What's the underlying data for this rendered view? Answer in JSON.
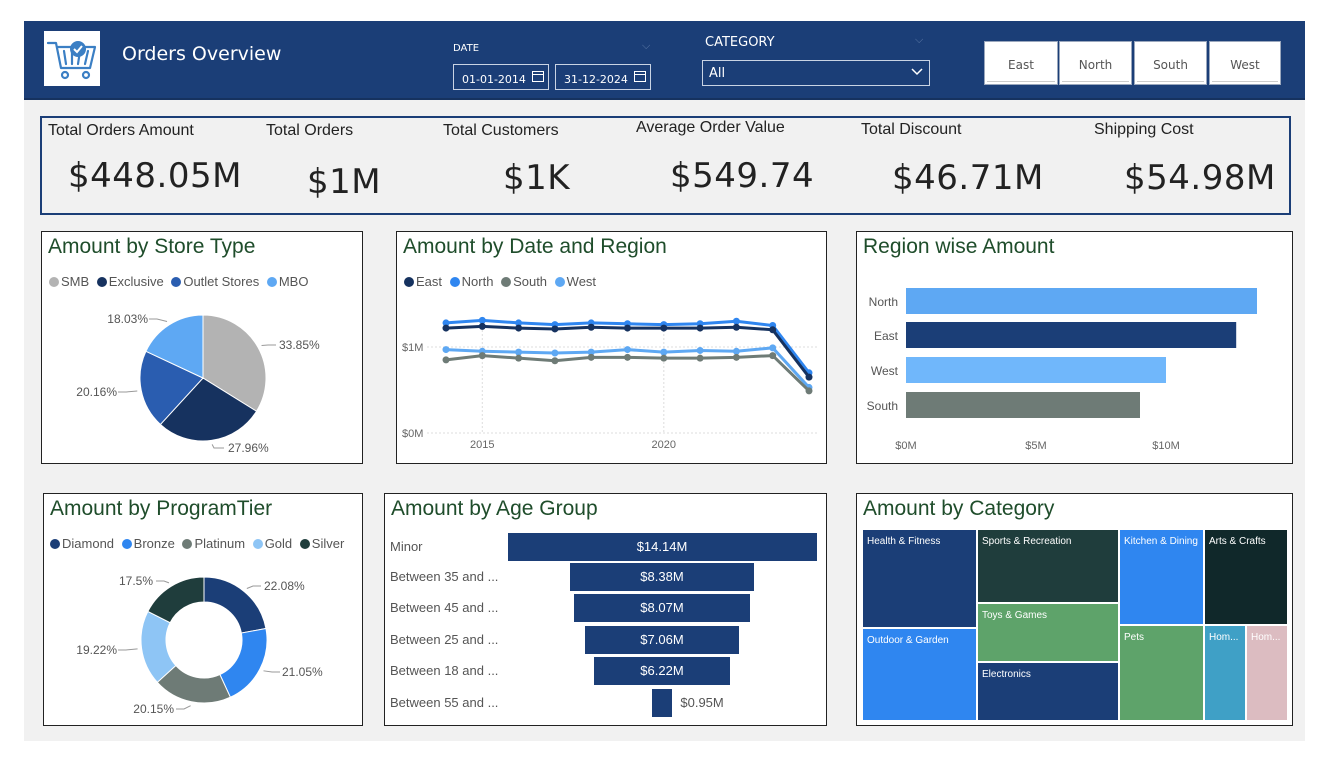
{
  "header": {
    "title": "Orders Overview",
    "date_label": "DATE",
    "date_from": "01-01-2014",
    "date_to": "31-12-2024",
    "category_label": "CATEGORY",
    "category_value": "All",
    "regions": [
      "East",
      "North",
      "South",
      "West"
    ]
  },
  "kpis": [
    {
      "label": "Total Orders Amount",
      "value": "$448.05M"
    },
    {
      "label": "Total Orders",
      "value": "$1M"
    },
    {
      "label": "Total Customers",
      "value": "$1K"
    },
    {
      "label": "Average Order Value",
      "value": "$549.74"
    },
    {
      "label": "Total Discount",
      "value": "$46.71M"
    },
    {
      "label": "Shipping Cost",
      "value": "$54.98M"
    }
  ],
  "colors": {
    "header": "#1b3e77",
    "navy": "#1b3e77",
    "blue": "#2f86f0",
    "light_blue": "#5ea8f3",
    "sky": "#70b7fb",
    "gray": "#b3b3b3",
    "slate": "#6e7b76",
    "dark_green": "#1f3d3c",
    "title_green": "#1f4d2b"
  },
  "store_type": {
    "title": "Amount by Store Type",
    "legend": [
      "SMB",
      "Exclusive",
      "Outlet Stores",
      "MBO"
    ]
  },
  "date_region": {
    "title": "Amount by Date and Region",
    "legend": [
      "East",
      "North",
      "South",
      "West"
    ],
    "y_ticks": [
      "$1M",
      "$0M"
    ],
    "x_ticks": [
      "2015",
      "2020"
    ]
  },
  "region_amount": {
    "title": "Region wise Amount",
    "x_ticks": [
      "$0M",
      "$5M",
      "$10M"
    ]
  },
  "program_tier": {
    "title": "Amount by ProgramTier",
    "legend": [
      "Diamond",
      "Bronze",
      "Platinum",
      "Gold",
      "Silver"
    ]
  },
  "age_group": {
    "title": "Amount by Age Group"
  },
  "category": {
    "title": "Amount by Category"
  },
  "chart_data": [
    {
      "type": "pie",
      "title": "Amount by Store Type",
      "labels": [
        "SMB",
        "Exclusive",
        "Outlet Stores",
        "MBO"
      ],
      "values": [
        33.85,
        27.96,
        20.16,
        18.03
      ],
      "data_labels": [
        "33.85%",
        "27.96%",
        "20.16%",
        "18.03%"
      ],
      "colors": [
        "#b3b3b3",
        "#16325f",
        "#2a5db0",
        "#5ea8f3"
      ],
      "legend": "top-left"
    },
    {
      "type": "line",
      "title": "Amount by Date and Region",
      "x": [
        2014,
        2015,
        2016,
        2017,
        2018,
        2019,
        2020,
        2021,
        2022,
        2023,
        2024
      ],
      "series": [
        {
          "name": "East",
          "color": "#16325f",
          "values": [
            1.22,
            1.24,
            1.22,
            1.21,
            1.23,
            1.22,
            1.22,
            1.22,
            1.23,
            1.2,
            0.65
          ]
        },
        {
          "name": "North",
          "color": "#2f86f0",
          "values": [
            1.28,
            1.31,
            1.28,
            1.26,
            1.28,
            1.27,
            1.26,
            1.27,
            1.3,
            1.25,
            0.7
          ]
        },
        {
          "name": "South",
          "color": "#6e7b76",
          "values": [
            0.85,
            0.9,
            0.87,
            0.84,
            0.88,
            0.88,
            0.87,
            0.87,
            0.88,
            0.9,
            0.49
          ]
        },
        {
          "name": "West",
          "color": "#5ea8f3",
          "values": [
            0.97,
            0.95,
            0.94,
            0.93,
            0.94,
            0.97,
            0.94,
            0.96,
            0.95,
            0.99,
            0.53
          ]
        }
      ],
      "y_ticks": [
        "$0M",
        "$1M"
      ],
      "x_ticks": [
        "2015",
        "2020"
      ],
      "legend": "top-left"
    },
    {
      "type": "bar",
      "orientation": "horizontal",
      "title": "Region wise Amount",
      "categories": [
        "North",
        "East",
        "West",
        "South"
      ],
      "values": [
        13.5,
        12.7,
        10.0,
        9.0
      ],
      "colors": [
        "#5ea8f3",
        "#1b3e77",
        "#70b7fb",
        "#6e7b76"
      ],
      "x_ticks": [
        "$0M",
        "$5M",
        "$10M"
      ],
      "xlim": [
        0,
        14
      ]
    },
    {
      "type": "pie",
      "title": "Amount by ProgramTier",
      "labels": [
        "Diamond",
        "Bronze",
        "Platinum",
        "Gold",
        "Silver"
      ],
      "values": [
        22.08,
        21.05,
        20.15,
        19.22,
        17.5
      ],
      "data_labels": [
        "22.08%",
        "21.05%",
        "20.15%",
        "19.22%",
        "17.5%"
      ],
      "colors": [
        "#1b3e77",
        "#2f86f0",
        "#6e7b76",
        "#8ec5f5",
        "#1f3d3c"
      ],
      "donut": true,
      "legend": "top-left"
    },
    {
      "type": "bar",
      "orientation": "horizontal",
      "title": "Amount by Age Group",
      "categories": [
        "Minor",
        "Between 35 and ...",
        "Between 45 and ...",
        "Between 25 and ...",
        "Between 18 and ...",
        "Between 55 and ..."
      ],
      "values": [
        14.14,
        8.38,
        8.07,
        7.06,
        6.22,
        0.95
      ],
      "data_labels": [
        "$14.14M",
        "$8.38M",
        "$8.07M",
        "$7.06M",
        "$6.22M",
        "$0.95M"
      ]
    },
    {
      "type": "treemap",
      "title": "Amount by Category",
      "labels": [
        "Health & Fitness",
        "Outdoor & Garden",
        "Sports & Recreation",
        "Toys & Games",
        "Electronics",
        "Kitchen & Dining",
        "Pets",
        "Arts & Crafts",
        "Hom...",
        "Hom..."
      ]
    }
  ]
}
